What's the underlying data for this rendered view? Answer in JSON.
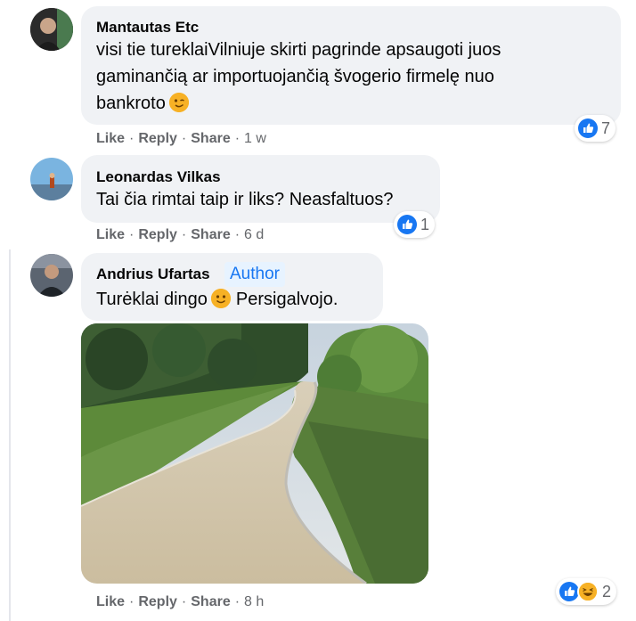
{
  "comments": [
    {
      "author": "Mantautas Etc",
      "text_lines": [
        "visi tie tureklaiVilniuje skirti pagrinde apsaugoti juos",
        "gaminančią ar importuojančią švogerio firmelę nuo",
        "bankroto"
      ],
      "emoji": "winking-face",
      "reaction_count": "7",
      "time": "1 w"
    },
    {
      "author": "Leonardas Vilkas",
      "text_lines": [
        "Tai čia rimtai taip ir liks? Neasfaltuos?"
      ],
      "reaction_count": "1",
      "time": "6 d"
    },
    {
      "author": "Andrius Ufartas",
      "badge": "Author",
      "text_before_emoji": "Turėklai dingo",
      "text_after_emoji": "Persigalvojo.",
      "emoji": "slightly-smiling-face",
      "reaction_count": "2",
      "time": "8 h"
    }
  ],
  "actions": {
    "like": "Like",
    "reply": "Reply",
    "share": "Share",
    "dot": "·"
  },
  "colors": {
    "bubble": "#f0f2f5",
    "secondary_text": "#65676b",
    "like_blue": "#1877f2",
    "badge_bg": "#e7f3ff"
  }
}
